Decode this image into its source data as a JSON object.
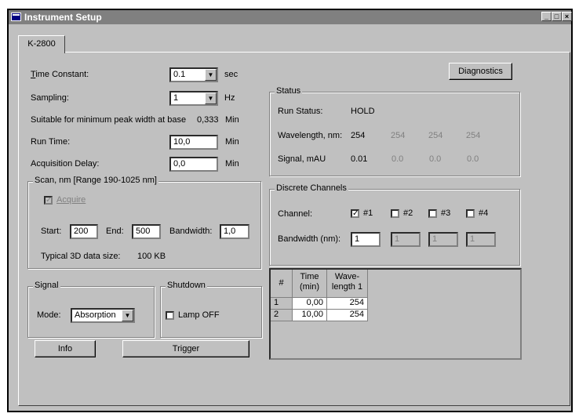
{
  "window": {
    "title": "Instrument Setup",
    "controls": [
      "_",
      "□",
      "×"
    ]
  },
  "tab": {
    "label": "K-2800"
  },
  "time_constant": {
    "label": "Time Constant:",
    "value": "0.1",
    "unit": "sec"
  },
  "sampling": {
    "label": "Sampling:",
    "value": "1",
    "unit": "Hz"
  },
  "peak_width": {
    "text": "Suitable for minimum peak width at base",
    "value": "0,333",
    "unit": "Min"
  },
  "run_time": {
    "label": "Run Time:",
    "value": "10,0",
    "unit": "Min"
  },
  "acq_delay": {
    "label": "Acquisition Delay:",
    "value": "0,0",
    "unit": "Min"
  },
  "scan": {
    "title": "Scan, nm [Range 190-1025 nm]",
    "acquire_label": "Acquire",
    "start_label": "Start:",
    "start_value": "200",
    "end_label": "End:",
    "end_value": "500",
    "bandwidth_label": "Bandwidth:",
    "bandwidth_value": "1,0",
    "size_label": "Typical 3D data size:",
    "size_value": "100 KB"
  },
  "signal": {
    "title": "Signal",
    "mode_label": "Mode:",
    "mode_value": "Absorption"
  },
  "shutdown": {
    "title": "Shutdown",
    "lamp_label": "Lamp OFF"
  },
  "buttons": {
    "info": "Info",
    "trigger": "Trigger",
    "diagnostics": "Diagnostics"
  },
  "status": {
    "title": "Status",
    "run_status_label": "Run Status:",
    "run_status_value": "HOLD",
    "wavelength_label": "Wavelength, nm:",
    "wavelength_values": [
      "254",
      "254",
      "254",
      "254"
    ],
    "signal_label": "Signal, mAU",
    "signal_values": [
      "0.01",
      "0.0",
      "0.0",
      "0.0"
    ]
  },
  "discrete": {
    "title": "Discrete Channels",
    "channel_label": "Channel:",
    "channels": [
      "#1",
      "#2",
      "#3",
      "#4"
    ],
    "bandwidth_label": "Bandwidth (nm):",
    "bandwidth_values": [
      "1",
      "1",
      "1",
      "1"
    ]
  },
  "timetable": {
    "headers": [
      "#",
      "Time (min)",
      "Wave- length 1"
    ],
    "header_time": [
      "Time",
      "(min)"
    ],
    "header_wave": [
      "Wave-",
      "length 1"
    ],
    "rows": [
      {
        "n": "1",
        "time": "0,00",
        "wave": "254"
      },
      {
        "n": "2",
        "time": "10,00",
        "wave": "254"
      }
    ]
  }
}
